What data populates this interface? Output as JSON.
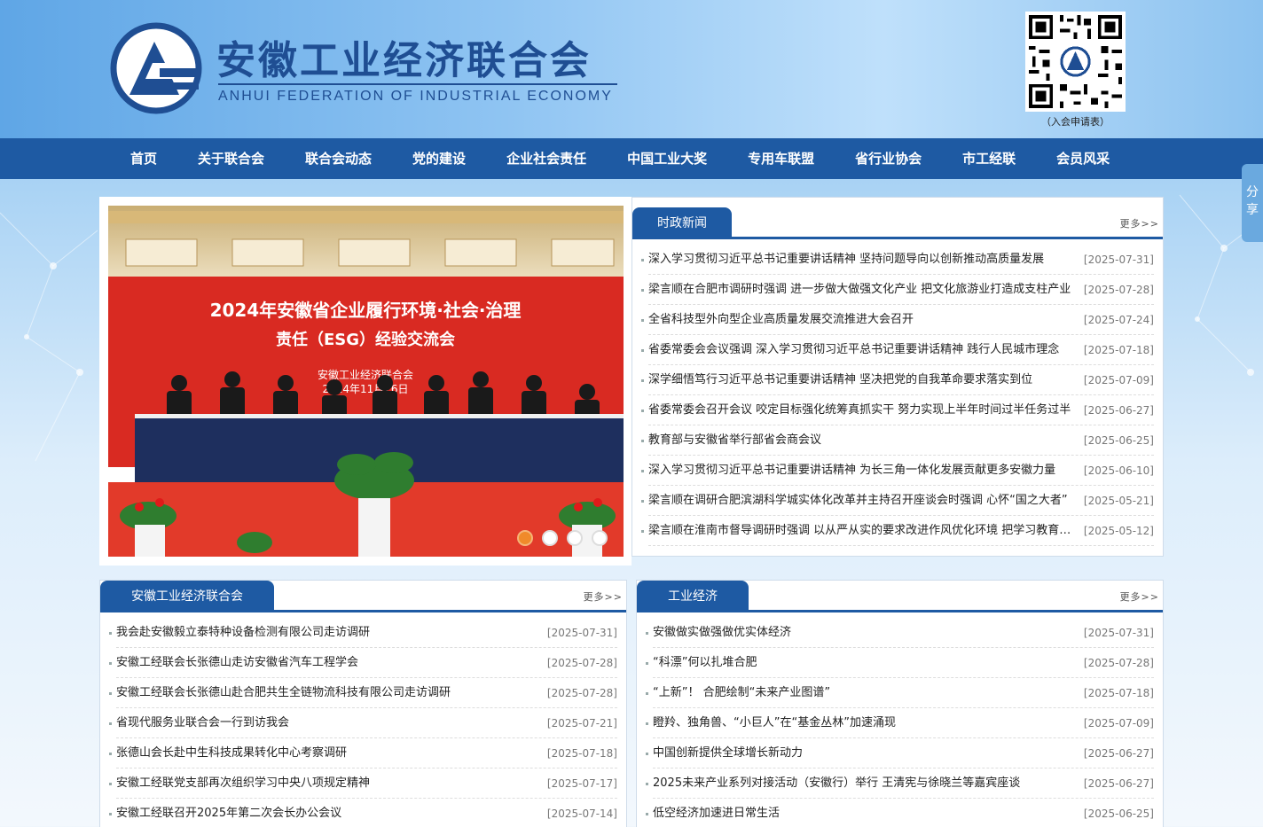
{
  "header": {
    "title_cn": "安徽工业经济联合会",
    "title_en": "ANHUI FEDERATION OF INDUSTRIAL ECONOMY",
    "qr_caption": "（入会申请表）"
  },
  "nav": {
    "items": [
      "首页",
      "关于联合会",
      "联合会动态",
      "党的建设",
      "企业社会责任",
      "中国工业大奖",
      "专用车联盟",
      "省行业协会",
      "市工经联",
      "会员风采"
    ]
  },
  "share": {
    "label": "分享"
  },
  "carousel": {
    "banner_line1": "2024年安徽省企业履行环境·社会·治理",
    "banner_line2": "责任（ESG）经验交流会",
    "banner_org": "安徽工业经济联合会",
    "banner_date": "2024年11月26日",
    "active_index": 0,
    "dot_count": 4
  },
  "politics_news": {
    "tab": "时政新闻",
    "more": "更多>>",
    "items": [
      {
        "title": "深入学习贯彻习近平总书记重要讲话精神 坚持问题导向以创新推动高质量发展",
        "date": "[2025-07-31]"
      },
      {
        "title": "梁言顺在合肥市调研时强调 进一步做大做强文化产业 把文化旅游业打造成支柱产业",
        "date": "[2025-07-28]"
      },
      {
        "title": "全省科技型外向型企业高质量发展交流推进大会召开",
        "date": "[2025-07-24]"
      },
      {
        "title": "省委常委会会议强调 深入学习贯彻习近平总书记重要讲话精神 践行人民城市理念",
        "date": "[2025-07-18]"
      },
      {
        "title": "深学细悟笃行习近平总书记重要讲话精神 坚决把党的自我革命要求落实到位",
        "date": "[2025-07-09]"
      },
      {
        "title": "省委常委会召开会议 咬定目标强化统筹真抓实干 努力实现上半年时间过半任务过半",
        "date": "[2025-06-27]"
      },
      {
        "title": "教育部与安徽省举行部省会商会议",
        "date": "[2025-06-25]"
      },
      {
        "title": "深入学习贯彻习近平总书记重要讲话精神 为长三角一体化发展贡献更多安徽力量",
        "date": "[2025-06-10]"
      },
      {
        "title": "梁言顺在调研合肥滨湖科学城实体化改革并主持召开座谈会时强调 心怀“国之大者”",
        "date": "[2025-05-21]"
      },
      {
        "title": "梁言顺在淮南市督导调研时强调 以从严从实的要求改进作风优化环境 把学习教育成果",
        "date": "[2025-05-12]"
      }
    ]
  },
  "federation_news": {
    "tab": "安徽工业经济联合会",
    "more": "更多>>",
    "items": [
      {
        "title": "我会赴安徽毅立泰特种设备检测有限公司走访调研",
        "date": "[2025-07-31]"
      },
      {
        "title": "安徽工经联会长张德山走访安徽省汽车工程学会",
        "date": "[2025-07-28]"
      },
      {
        "title": "安徽工经联会长张德山赴合肥共生全链物流科技有限公司走访调研",
        "date": "[2025-07-28]"
      },
      {
        "title": "省现代服务业联合会一行到访我会",
        "date": "[2025-07-21]"
      },
      {
        "title": "张德山会长赴中生科技成果转化中心考察调研",
        "date": "[2025-07-18]"
      },
      {
        "title": "安徽工经联党支部再次组织学习中央八项规定精神",
        "date": "[2025-07-17]"
      },
      {
        "title": "安徽工经联召开2025年第二次会长办公会议",
        "date": "[2025-07-14]"
      }
    ]
  },
  "industry_news": {
    "tab": "工业经济",
    "more": "更多>>",
    "items": [
      {
        "title": "安徽做实做强做优实体经济",
        "date": "[2025-07-31]"
      },
      {
        "title": "“科漂”何以扎堆合肥",
        "date": "[2025-07-28]"
      },
      {
        "title": "“上新”！ 合肥绘制“未来产业图谱”",
        "date": "[2025-07-18]"
      },
      {
        "title": "瞪羚、独角兽、“小巨人”在“基金丛林”加速涌现",
        "date": "[2025-07-09]"
      },
      {
        "title": "中国创新提供全球增长新动力",
        "date": "[2025-06-27]"
      },
      {
        "title": "2025未来产业系列对接活动（安徽行）举行 王清宪与徐晓兰等嘉宾座谈",
        "date": "[2025-06-27]"
      },
      {
        "title": "低空经济加速进日常生活",
        "date": "[2025-06-25]"
      }
    ]
  },
  "colors": {
    "primary": "#1e5aa3",
    "accent": "#f08a2a"
  }
}
